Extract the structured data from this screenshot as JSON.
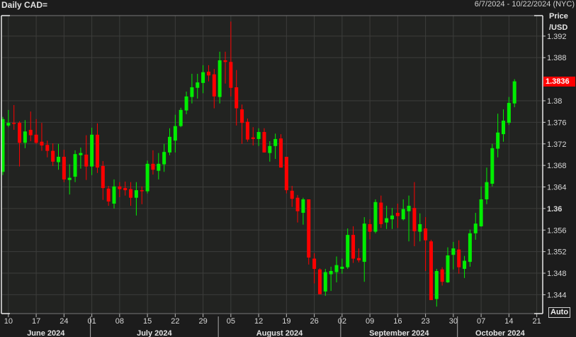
{
  "header": {
    "title": "Daily CAD=",
    "range": "6/7/2024 - 10/22/2024 (NYC)"
  },
  "axis": {
    "price_label_1": "Price",
    "price_label_2": "/USD",
    "auto_label": "Auto"
  },
  "chart_data": {
    "type": "candlestick",
    "title": "Daily CAD=",
    "ylabel": "Price /USD",
    "ylim": [
      1.3405,
      1.3958
    ],
    "grid": true,
    "year": 2024,
    "up_color": "#00ee00",
    "down_color": "#ff0000",
    "last_price": "1.3836",
    "last_price_color": "#ff0000",
    "y_ticks": [
      {
        "value": 1.392,
        "label": "1.392"
      },
      {
        "value": 1.388,
        "label": "1.388"
      },
      {
        "value": 1.38,
        "label": "1.38"
      },
      {
        "value": 1.376,
        "label": "1.376"
      },
      {
        "value": 1.372,
        "label": "1.372"
      },
      {
        "value": 1.368,
        "label": "1.368"
      },
      {
        "value": 1.364,
        "label": "1.364"
      },
      {
        "value": 1.36,
        "label": "1.36",
        "bold": true
      },
      {
        "value": 1.356,
        "label": "1.356"
      },
      {
        "value": 1.352,
        "label": "1.352"
      },
      {
        "value": 1.348,
        "label": "1.348"
      },
      {
        "value": 1.344,
        "label": "1.344"
      }
    ],
    "x_ticks": [
      {
        "date": "06-10",
        "label": "10"
      },
      {
        "date": "06-17",
        "label": "17"
      },
      {
        "date": "06-24",
        "label": "24"
      },
      {
        "date": "07-01",
        "label": "01"
      },
      {
        "date": "07-08",
        "label": "08"
      },
      {
        "date": "07-15",
        "label": "15"
      },
      {
        "date": "07-22",
        "label": "22"
      },
      {
        "date": "07-29",
        "label": "29"
      },
      {
        "date": "08-05",
        "label": "05"
      },
      {
        "date": "08-12",
        "label": "12"
      },
      {
        "date": "08-19",
        "label": "19"
      },
      {
        "date": "08-26",
        "label": "26"
      },
      {
        "date": "09-02",
        "label": "02"
      },
      {
        "date": "09-09",
        "label": "09"
      },
      {
        "date": "09-16",
        "label": "16"
      },
      {
        "date": "09-23",
        "label": "23"
      },
      {
        "date": "09-30",
        "label": "30"
      },
      {
        "date": "10-07",
        "label": "07"
      },
      {
        "date": "10-14",
        "label": "14"
      },
      {
        "date": "10-21",
        "label": "21"
      }
    ],
    "months": [
      {
        "month": "06",
        "label": "June 2024"
      },
      {
        "month": "07",
        "label": "July 2024"
      },
      {
        "month": "08",
        "label": "August 2024"
      },
      {
        "month": "09",
        "label": "September 2024"
      },
      {
        "month": "10",
        "label": "October 2024"
      }
    ],
    "candles_columns": [
      "date",
      "open",
      "high",
      "low",
      "close"
    ],
    "candles": [
      [
        "06-07",
        1.3668,
        1.377,
        1.3662,
        1.3766
      ],
      [
        "06-10",
        1.3754,
        1.3783,
        1.3751,
        1.3759
      ],
      [
        "06-11",
        1.3759,
        1.3792,
        1.3746,
        1.3757
      ],
      [
        "06-12",
        1.3759,
        1.3762,
        1.3678,
        1.3722
      ],
      [
        "06-13",
        1.3722,
        1.3764,
        1.3712,
        1.3743
      ],
      [
        "06-14",
        1.3746,
        1.378,
        1.3725,
        1.3736
      ],
      [
        "06-17",
        1.3737,
        1.3766,
        1.372,
        1.3722
      ],
      [
        "06-18",
        1.3724,
        1.3759,
        1.3707,
        1.3717
      ],
      [
        "06-19",
        1.3718,
        1.3726,
        1.3695,
        1.3707
      ],
      [
        "06-20",
        1.3707,
        1.3721,
        1.3679,
        1.3687
      ],
      [
        "06-21",
        1.3686,
        1.372,
        1.3672,
        1.3696
      ],
      [
        "06-24",
        1.3696,
        1.3709,
        1.3649,
        1.3654
      ],
      [
        "06-25",
        1.3653,
        1.3682,
        1.3626,
        1.3657
      ],
      [
        "06-26",
        1.3659,
        1.3708,
        1.3649,
        1.3701
      ],
      [
        "06-27",
        1.3699,
        1.3713,
        1.3674,
        1.3703
      ],
      [
        "06-28",
        1.37,
        1.3736,
        1.3653,
        1.3678
      ],
      [
        "07-01",
        1.3678,
        1.375,
        1.3662,
        1.3737
      ],
      [
        "07-02",
        1.3737,
        1.3758,
        1.3666,
        1.3676
      ],
      [
        "07-03",
        1.3679,
        1.3688,
        1.3616,
        1.3638
      ],
      [
        "07-04",
        1.3637,
        1.3642,
        1.3605,
        1.3613
      ],
      [
        "07-05",
        1.3609,
        1.3654,
        1.36,
        1.3641
      ],
      [
        "07-08",
        1.3641,
        1.3649,
        1.3621,
        1.3636
      ],
      [
        "07-09",
        1.3638,
        1.365,
        1.3624,
        1.3634
      ],
      [
        "07-10",
        1.3636,
        1.3649,
        1.3605,
        1.362
      ],
      [
        "07-11",
        1.362,
        1.3649,
        1.3587,
        1.3634
      ],
      [
        "07-12",
        1.3634,
        1.3641,
        1.3608,
        1.3633
      ],
      [
        "07-15",
        1.3632,
        1.3689,
        1.3628,
        1.3683
      ],
      [
        "07-16",
        1.3683,
        1.3708,
        1.3663,
        1.3672
      ],
      [
        "07-17",
        1.367,
        1.3703,
        1.3654,
        1.3683
      ],
      [
        "07-18",
        1.3682,
        1.372,
        1.3668,
        1.3705
      ],
      [
        "07-19",
        1.3704,
        1.3749,
        1.3699,
        1.3733
      ],
      [
        "07-22",
        1.3726,
        1.3774,
        1.3704,
        1.3753
      ],
      [
        "07-23",
        1.3753,
        1.3787,
        1.3751,
        1.3783
      ],
      [
        "07-24",
        1.3782,
        1.3817,
        1.3775,
        1.3808
      ],
      [
        "07-25",
        1.3807,
        1.385,
        1.3795,
        1.3825
      ],
      [
        "07-26",
        1.3824,
        1.385,
        1.3804,
        1.3834
      ],
      [
        "07-29",
        1.3833,
        1.3866,
        1.3814,
        1.3853
      ],
      [
        "07-30",
        1.3854,
        1.3866,
        1.3836,
        1.3847
      ],
      [
        "07-31",
        1.3849,
        1.3859,
        1.3786,
        1.3808
      ],
      [
        "08-01",
        1.3807,
        1.3891,
        1.3795,
        1.3875
      ],
      [
        "08-02",
        1.3875,
        1.3891,
        1.3832,
        1.3872
      ],
      [
        "08-05",
        1.3872,
        1.3947,
        1.3808,
        1.3824
      ],
      [
        "08-06",
        1.3825,
        1.3857,
        1.3754,
        1.3786
      ],
      [
        "08-07",
        1.3784,
        1.3793,
        1.372,
        1.3759
      ],
      [
        "08-08",
        1.3761,
        1.3767,
        1.3724,
        1.3728
      ],
      [
        "08-09",
        1.3732,
        1.3751,
        1.3717,
        1.3729
      ],
      [
        "08-12",
        1.3729,
        1.3749,
        1.3716,
        1.3742
      ],
      [
        "08-13",
        1.3742,
        1.3749,
        1.3704,
        1.3704
      ],
      [
        "08-14",
        1.3703,
        1.3725,
        1.3687,
        1.3716
      ],
      [
        "08-15",
        1.3716,
        1.3739,
        1.3692,
        1.3729
      ],
      [
        "08-16",
        1.373,
        1.3738,
        1.3676,
        1.3676
      ],
      [
        "08-19",
        1.3696,
        1.3696,
        1.3628,
        1.3634
      ],
      [
        "08-20",
        1.3633,
        1.3642,
        1.3603,
        1.3618
      ],
      [
        "08-21",
        1.362,
        1.3625,
        1.3574,
        1.3595
      ],
      [
        "08-22",
        1.3592,
        1.362,
        1.357,
        1.3617
      ],
      [
        "08-23",
        1.3617,
        1.3617,
        1.3496,
        1.3509
      ],
      [
        "08-26",
        1.3507,
        1.3517,
        1.3461,
        1.3488
      ],
      [
        "08-27",
        1.3487,
        1.3489,
        1.3441,
        1.3441
      ],
      [
        "08-28",
        1.3446,
        1.3488,
        1.3438,
        1.3482
      ],
      [
        "08-29",
        1.3478,
        1.3492,
        1.3447,
        1.3484
      ],
      [
        "08-30",
        1.3482,
        1.3511,
        1.3463,
        1.3495
      ],
      [
        "09-02",
        1.3488,
        1.3507,
        1.3479,
        1.3492
      ],
      [
        "09-03",
        1.3491,
        1.3563,
        1.3488,
        1.3551
      ],
      [
        "09-04",
        1.3551,
        1.3567,
        1.3499,
        1.3507
      ],
      [
        "09-05",
        1.3508,
        1.3526,
        1.35,
        1.3504
      ],
      [
        "09-06",
        1.3501,
        1.3584,
        1.3464,
        1.3572
      ],
      [
        "09-09",
        1.3571,
        1.358,
        1.3543,
        1.3557
      ],
      [
        "09-10",
        1.3557,
        1.3617,
        1.3554,
        1.3612
      ],
      [
        "09-11",
        1.3611,
        1.3624,
        1.3564,
        1.3571
      ],
      [
        "09-12",
        1.3574,
        1.3605,
        1.3562,
        1.3582
      ],
      [
        "09-13",
        1.358,
        1.3601,
        1.3562,
        1.3587
      ],
      [
        "09-16",
        1.3592,
        1.3609,
        1.3564,
        1.3586
      ],
      [
        "09-17",
        1.358,
        1.3617,
        1.3578,
        1.3599
      ],
      [
        "09-18",
        1.3595,
        1.3624,
        1.3539,
        1.3605
      ],
      [
        "09-19",
        1.3601,
        1.3649,
        1.353,
        1.3558
      ],
      [
        "09-20",
        1.3557,
        1.3591,
        1.3539,
        1.3571
      ],
      [
        "09-23",
        1.3563,
        1.3584,
        1.3484,
        1.3541
      ],
      [
        "09-24",
        1.3539,
        1.3542,
        1.343,
        1.343
      ],
      [
        "09-25",
        1.3432,
        1.3488,
        1.3418,
        1.3484
      ],
      [
        "09-26",
        1.3487,
        1.3491,
        1.3457,
        1.3464
      ],
      [
        "09-27",
        1.3463,
        1.3528,
        1.3462,
        1.3513
      ],
      [
        "09-30",
        1.3514,
        1.3538,
        1.3487,
        1.3526
      ],
      [
        "10-01",
        1.3524,
        1.3541,
        1.3479,
        1.3491
      ],
      [
        "10-02",
        1.3488,
        1.3512,
        1.3471,
        1.3503
      ],
      [
        "10-03",
        1.3501,
        1.3561,
        1.3492,
        1.3554
      ],
      [
        "10-04",
        1.3554,
        1.3592,
        1.3542,
        1.3572
      ],
      [
        "10-07",
        1.3567,
        1.3641,
        1.3566,
        1.3617
      ],
      [
        "10-08",
        1.3617,
        1.3676,
        1.3608,
        1.3649
      ],
      [
        "10-09",
        1.3646,
        1.372,
        1.3641,
        1.3712
      ],
      [
        "10-10",
        1.3711,
        1.3776,
        1.3695,
        1.3741
      ],
      [
        "10-11",
        1.3738,
        1.3784,
        1.3724,
        1.3763
      ],
      [
        "10-14",
        1.3759,
        1.3807,
        1.3755,
        1.3796
      ],
      [
        "10-15",
        1.3795,
        1.384,
        1.3788,
        1.3836
      ]
    ]
  }
}
